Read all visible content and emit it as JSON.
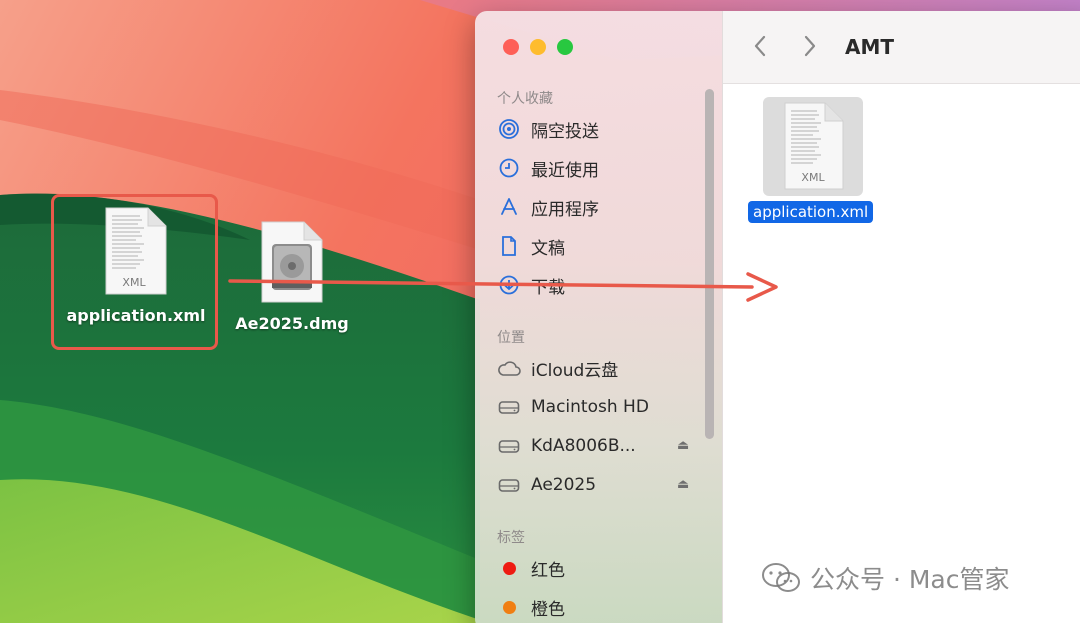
{
  "desktop": {
    "icons": [
      {
        "label": "application.xml",
        "badge": "XML",
        "icon": "xml-file-icon"
      },
      {
        "label": "Ae2025.dmg",
        "icon": "disk-image-icon"
      }
    ],
    "highlight_color": "#e8594a"
  },
  "finder": {
    "title": "AMT",
    "sidebar": {
      "favorites_header": "个人收藏",
      "favorites": [
        {
          "label": "隔空投送",
          "icon": "airdrop-icon"
        },
        {
          "label": "最近使用",
          "icon": "clock-icon"
        },
        {
          "label": "应用程序",
          "icon": "applications-icon"
        },
        {
          "label": "文稿",
          "icon": "document-icon"
        },
        {
          "label": "下载",
          "icon": "download-icon"
        }
      ],
      "locations_header": "位置",
      "locations": [
        {
          "label": "iCloud云盘",
          "icon": "cloud-icon",
          "eject": false
        },
        {
          "label": "Macintosh HD",
          "icon": "drive-icon",
          "eject": false
        },
        {
          "label": "KdA8006B...",
          "icon": "drive-icon",
          "eject": true
        },
        {
          "label": "Ae2025",
          "icon": "drive-icon",
          "eject": true
        }
      ],
      "tags_header": "标签",
      "tags": [
        {
          "label": "红色",
          "color": "#ee1b12"
        },
        {
          "label": "橙色",
          "color": "#f07f13"
        }
      ]
    },
    "content": {
      "files": [
        {
          "name": "application.xml",
          "badge": "XML",
          "selected": true
        }
      ]
    },
    "accent": "#1167e6"
  },
  "watermark": {
    "text": "公众号 · Mac管家"
  },
  "arrow_color": "#e8594a"
}
